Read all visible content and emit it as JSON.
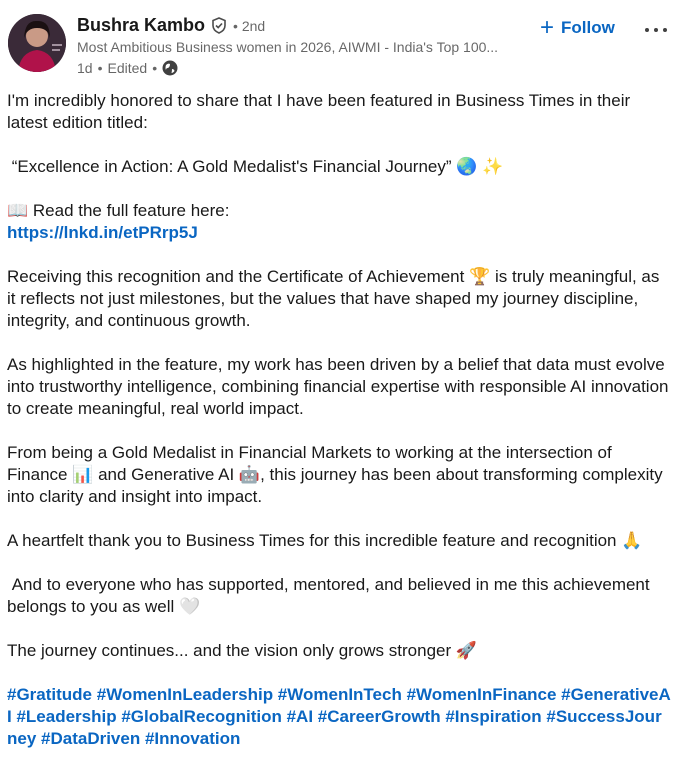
{
  "author": {
    "name": "Bushra Kambo",
    "degree": "• 2nd",
    "headline": "Most Ambitious Business women in 2026, AIWMI - India's Top 100...",
    "time": "1d",
    "edited": "Edited"
  },
  "actions": {
    "follow_label": "Follow"
  },
  "post": {
    "p1": "I'm incredibly honored to share that I have been featured in Business Times in their latest edition titled:",
    "p2": " “Excellence in Action: A Gold Medalist's Financial Journey” 🌏 ✨",
    "p3": "📖 Read the full feature here:",
    "link": "https://lnkd.in/etPRrp5J",
    "p4": "Receiving this recognition and the Certificate of Achievement 🏆 is truly meaningful, as it reflects not just milestones, but the values that have shaped my journey discipline, integrity, and continuous growth.",
    "p5": "As highlighted in the feature, my work has been driven by a belief that data must evolve into trustworthy intelligence, combining financial expertise with responsible AI innovation to create meaningful, real world impact.",
    "p6": "From being a Gold Medalist in Financial Markets to working at the intersection of Finance 📊 and Generative AI 🤖, this journey has been about transforming complexity into clarity and insight into impact.",
    "p7": "A heartfelt thank you to Business Times for this incredible feature and recognition 🙏",
    "p8": " And to everyone who has supported, mentored, and believed in me this achievement belongs to you as well 🤍",
    "p9": "The journey continues... and the vision only grows stronger 🚀",
    "hashtags": "#Gratitude #WomenInLeadership #WomenInTech #WomenInFinance #GenerativeAI #Leadership #GlobalRecognition #AI #CareerGrowth #Inspiration #SuccessJourney #DataDriven #Innovation"
  },
  "icons": {
    "verified": "shield-check-icon",
    "globe": "globe-icon",
    "more": "more-horizontal-icon"
  },
  "colors": {
    "accent": "#0a66c2",
    "text": "#191919",
    "muted": "#666666"
  }
}
